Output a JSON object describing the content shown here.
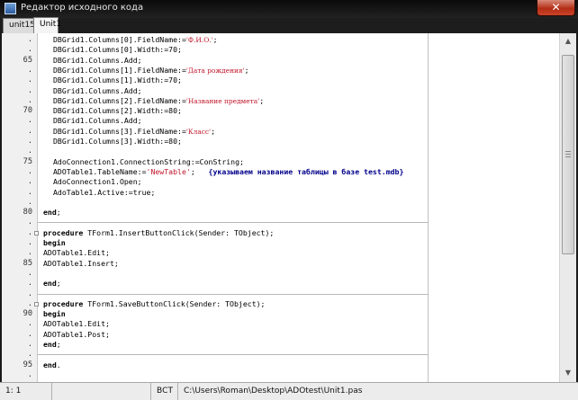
{
  "window": {
    "title": "Редактор исходного кода",
    "close_label": "✕"
  },
  "tabs": [
    {
      "label": "unit15"
    },
    {
      "label": "Unit1"
    }
  ],
  "editor": {
    "lines": [
      {
        "n": ".",
        "parts": [
          {
            "t": "DBGrid1.Columns[0].FieldName:="
          },
          {
            "t": "'Ф.И.О.'",
            "c": "cyr"
          },
          {
            "t": ";"
          }
        ]
      },
      {
        "n": ".",
        "parts": [
          {
            "t": "DBGrid1.Columns[0].Width:=70;"
          }
        ]
      },
      {
        "n": "65",
        "parts": [
          {
            "t": "DBGrid1.Columns.Add;"
          }
        ]
      },
      {
        "n": ".",
        "parts": [
          {
            "t": "DBGrid1.Columns[1].FieldName:="
          },
          {
            "t": "'Дата рождения'",
            "c": "cyr"
          },
          {
            "t": ";"
          }
        ]
      },
      {
        "n": ".",
        "parts": [
          {
            "t": "DBGrid1.Columns[1].Width:=70;"
          }
        ]
      },
      {
        "n": ".",
        "parts": [
          {
            "t": "DBGrid1.Columns.Add;"
          }
        ]
      },
      {
        "n": ".",
        "parts": [
          {
            "t": "DBGrid1.Columns[2].FieldName:="
          },
          {
            "t": "'Название предмета'",
            "c": "cyr"
          },
          {
            "t": ";"
          }
        ]
      },
      {
        "n": "70",
        "parts": [
          {
            "t": "DBGrid1.Columns[2].Width:=80;"
          }
        ]
      },
      {
        "n": ".",
        "parts": [
          {
            "t": "DBGrid1.Columns.Add;"
          }
        ]
      },
      {
        "n": ".",
        "parts": [
          {
            "t": "DBGrid1.Columns[3].FieldName:="
          },
          {
            "t": "'Класс'",
            "c": "cyr"
          },
          {
            "t": ";"
          }
        ]
      },
      {
        "n": ".",
        "parts": [
          {
            "t": "DBGrid1.Columns[3].Width:=80;"
          }
        ]
      },
      {
        "n": ".",
        "parts": []
      },
      {
        "n": "75",
        "parts": [
          {
            "t": "AdoConnection1.ConnectionString:=ConString;"
          }
        ]
      },
      {
        "n": ".",
        "parts": [
          {
            "t": "ADOTable1.TableName:="
          },
          {
            "t": "'NewTable'",
            "c": "str"
          },
          {
            "t": ";   "
          },
          {
            "t": "{указываем название таблицы в базе test.mdb}",
            "c": "cmt"
          }
        ]
      },
      {
        "n": ".",
        "parts": [
          {
            "t": "AdoConnection1.Open;"
          }
        ]
      },
      {
        "n": ".",
        "parts": [
          {
            "t": "AdoTable1.Active:=true;"
          }
        ]
      },
      {
        "n": ".",
        "parts": []
      },
      {
        "n": "80",
        "parts": [
          {
            "t": "end",
            "c": "kw"
          },
          {
            "t": ";"
          }
        ]
      },
      {
        "n": ".",
        "parts": []
      },
      {
        "n": ".",
        "parts": [
          {
            "t": "procedure",
            "c": "kw"
          },
          {
            "t": " TForm1.InsertButtonClick(Sender: TObject);"
          }
        ]
      },
      {
        "n": ".",
        "parts": [
          {
            "t": "begin",
            "c": "kw"
          }
        ]
      },
      {
        "n": ".",
        "parts": [
          {
            "t": "ADOTable1.Edit;"
          }
        ]
      },
      {
        "n": "85",
        "parts": [
          {
            "t": "ADOTable1.Insert;"
          }
        ]
      },
      {
        "n": ".",
        "parts": []
      },
      {
        "n": ".",
        "parts": [
          {
            "t": "end",
            "c": "kw"
          },
          {
            "t": ";"
          }
        ]
      },
      {
        "n": ".",
        "parts": []
      },
      {
        "n": ".",
        "parts": [
          {
            "t": "procedure",
            "c": "kw"
          },
          {
            "t": " TForm1.SaveButtonClick(Sender: TObject);"
          }
        ]
      },
      {
        "n": "90",
        "parts": [
          {
            "t": "begin",
            "c": "kw"
          }
        ]
      },
      {
        "n": ".",
        "parts": [
          {
            "t": "ADOTable1.Edit;"
          }
        ]
      },
      {
        "n": ".",
        "parts": [
          {
            "t": "ADOTable1.Post;"
          }
        ]
      },
      {
        "n": ".",
        "parts": [
          {
            "t": "end",
            "c": "kw"
          },
          {
            "t": ";"
          }
        ]
      },
      {
        "n": ".",
        "parts": []
      },
      {
        "n": "95",
        "parts": [
          {
            "t": "end",
            "c": "kw"
          },
          {
            "t": "."
          }
        ]
      },
      {
        "n": ".",
        "parts": []
      }
    ]
  },
  "status": {
    "position": "1:  1",
    "mode": "",
    "insert": "ВСТ",
    "path": "C:\\Users\\Roman\\Desktop\\ADOtest\\Unit1.pas"
  }
}
